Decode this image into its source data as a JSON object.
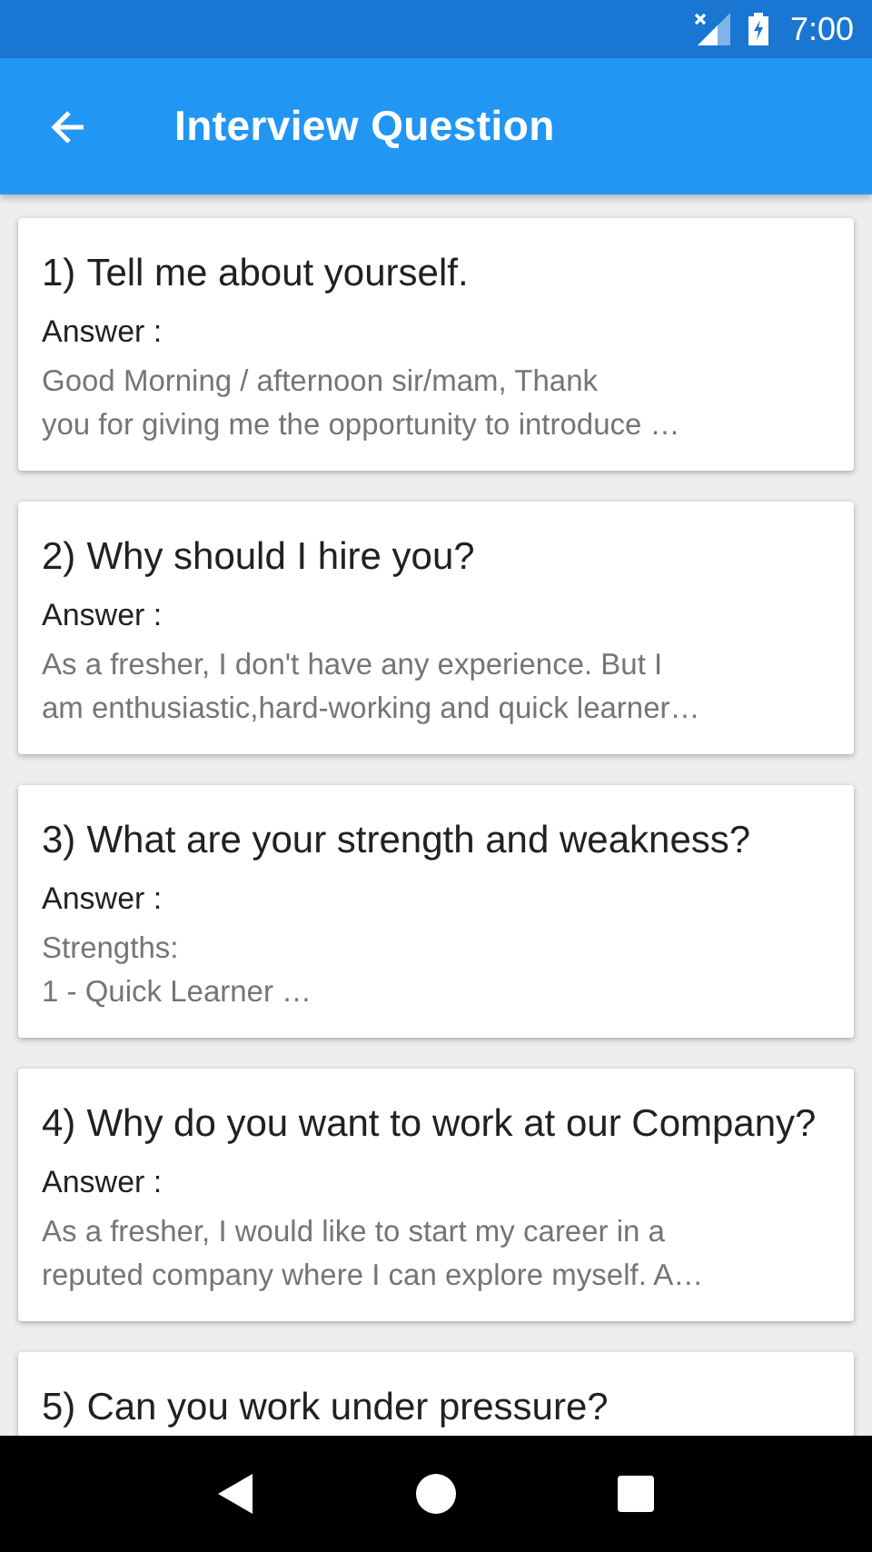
{
  "status_bar": {
    "time": "7:00"
  },
  "app_bar": {
    "title": "Interview Question"
  },
  "questions": [
    {
      "number": "1)",
      "question": "Tell me about yourself.",
      "answer_label": "Answer :",
      "answer_lines": [
        "Good Morning / afternoon sir/mam, Thank",
        "you for giving me the opportunity to introduce …"
      ]
    },
    {
      "number": "2)",
      "question": "Why should I hire you?",
      "answer_label": "Answer :",
      "answer_lines": [
        "As a fresher, I don't have any experience. But I",
        "am enthusiastic,hard-working and quick learner…"
      ]
    },
    {
      "number": "3)",
      "question": "What are your strength and weakness?",
      "answer_label": "Answer :",
      "answer_lines": [
        "Strengths:",
        "1 - Quick Learner …"
      ]
    },
    {
      "number": "4)",
      "question": "Why do you want to work at our Company?",
      "answer_label": "Answer :",
      "answer_lines": [
        "As a fresher, I would like to start my career in a",
        "reputed company where I can explore myself. A…"
      ]
    },
    {
      "number": "5)",
      "question": "Can you work under pressure?"
    }
  ]
}
